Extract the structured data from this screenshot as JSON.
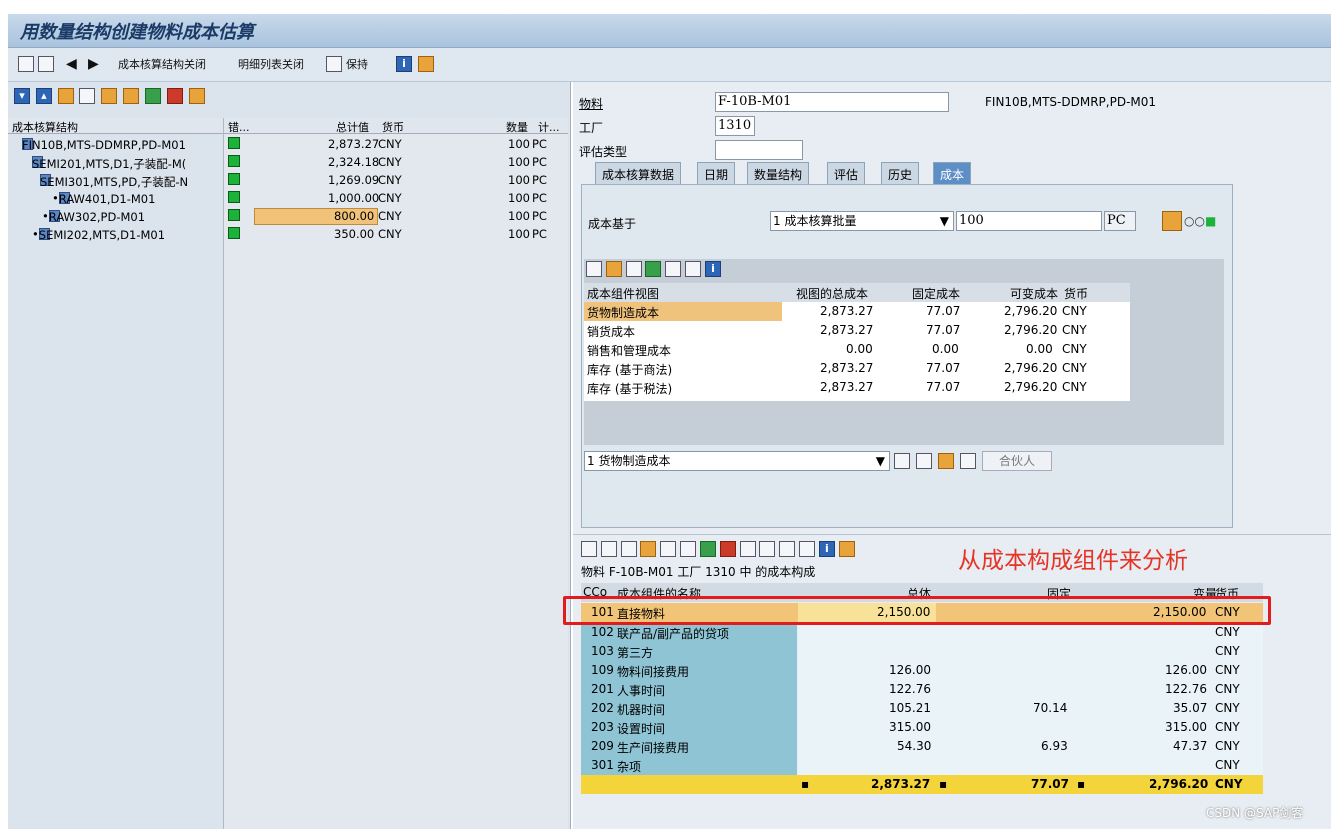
{
  "window": {
    "title": "用数量结构创建物料成本估算"
  },
  "toolbar": {
    "btn_close_structure": "成本核算结构关闭",
    "btn_close_detail": "明细列表关闭",
    "btn_save": "保持"
  },
  "tree": {
    "headers": {
      "structure": "成本核算结构",
      "error": "错...",
      "total": "总计值",
      "currency": "货币",
      "qty": "数量",
      "unit": "计..."
    },
    "rows": [
      {
        "label": "FIN10B,MTS-DDMRP,PD-M01",
        "total": "2,873.27",
        "currency": "CNY",
        "qty": "100",
        "unit": "PC"
      },
      {
        "label": "SEMI201,MTS,D1,子装配-M(",
        "total": "2,324.18",
        "currency": "CNY",
        "qty": "100",
        "unit": "PC"
      },
      {
        "label": "SEMI301,MTS,PD,子装配-N",
        "total": "1,269.09",
        "currency": "CNY",
        "qty": "100",
        "unit": "PC"
      },
      {
        "label": "RAW401,D1-M01",
        "total": "1,000.00",
        "currency": "CNY",
        "qty": "100",
        "unit": "PC"
      },
      {
        "label": "RAW302,PD-M01",
        "total": "800.00",
        "currency": "CNY",
        "qty": "100",
        "unit": "PC"
      },
      {
        "label": "SEMI202,MTS,D1-M01",
        "total": "350.00",
        "currency": "CNY",
        "qty": "100",
        "unit": "PC"
      }
    ]
  },
  "header_form": {
    "material_label": "物料",
    "material_value": "F-10B-M01",
    "material_desc": "FIN10B,MTS-DDMRP,PD-M01",
    "plant_label": "工厂",
    "plant_value": "1310",
    "valuation_label": "评估类型",
    "valuation_value": ""
  },
  "tabs": [
    "成本核算数据",
    "日期",
    "数量结构",
    "评估",
    "历史",
    "成本"
  ],
  "costs_tab": {
    "cost_basis_label": "成本基于",
    "cost_basis_select": "1 成本核算批量",
    "lot_size": "100",
    "lot_unit": "PC",
    "table_headers": [
      "成本组件视图",
      "视图的总成本",
      "固定成本",
      "可变成本",
      "货币"
    ],
    "rows": [
      [
        "货物制造成本",
        "2,873.27",
        "77.07",
        "2,796.20",
        "CNY"
      ],
      [
        "销货成本",
        "2,873.27",
        "77.07",
        "2,796.20",
        "CNY"
      ],
      [
        "销售和管理成本",
        "0.00",
        "0.00",
        "0.00",
        "CNY"
      ],
      [
        "库存 (基于商法)",
        "2,873.27",
        "77.07",
        "2,796.20",
        "CNY"
      ],
      [
        "库存 (基于税法)",
        "2,873.27",
        "77.07",
        "2,796.20",
        "CNY"
      ]
    ],
    "view_select": "1 货物制造成本",
    "partner_btn": "合伙人"
  },
  "cost_components": {
    "caption": "物料 F-10B-M01 工厂 1310 中 的成本构成",
    "headers": [
      "CCo",
      "成本组件的名称",
      "总体",
      "固定",
      "变量",
      "货币"
    ],
    "rows": [
      [
        "101",
        "直接物料",
        "2,150.00",
        "",
        "2,150.00",
        "CNY"
      ],
      [
        "102",
        "联产品/副产品的贷项",
        "",
        "",
        "",
        "CNY"
      ],
      [
        "103",
        "第三方",
        "",
        "",
        "",
        "CNY"
      ],
      [
        "109",
        "物料间接费用",
        "126.00",
        "",
        "126.00",
        "CNY"
      ],
      [
        "201",
        "人事时间",
        "122.76",
        "",
        "122.76",
        "CNY"
      ],
      [
        "202",
        "机器时间",
        "105.21",
        "70.14",
        "35.07",
        "CNY"
      ],
      [
        "203",
        "设置时间",
        "315.00",
        "",
        "315.00",
        "CNY"
      ],
      [
        "209",
        "生产间接费用",
        "54.30",
        "6.93",
        "47.37",
        "CNY"
      ],
      [
        "301",
        "杂项",
        "",
        "",
        "",
        "CNY"
      ]
    ],
    "total": [
      "2,873.27",
      "77.07",
      "2,796.20",
      "CNY"
    ]
  },
  "annotation": "从成本构成组件来分析",
  "watermark": "CSDN @SAP剑客"
}
